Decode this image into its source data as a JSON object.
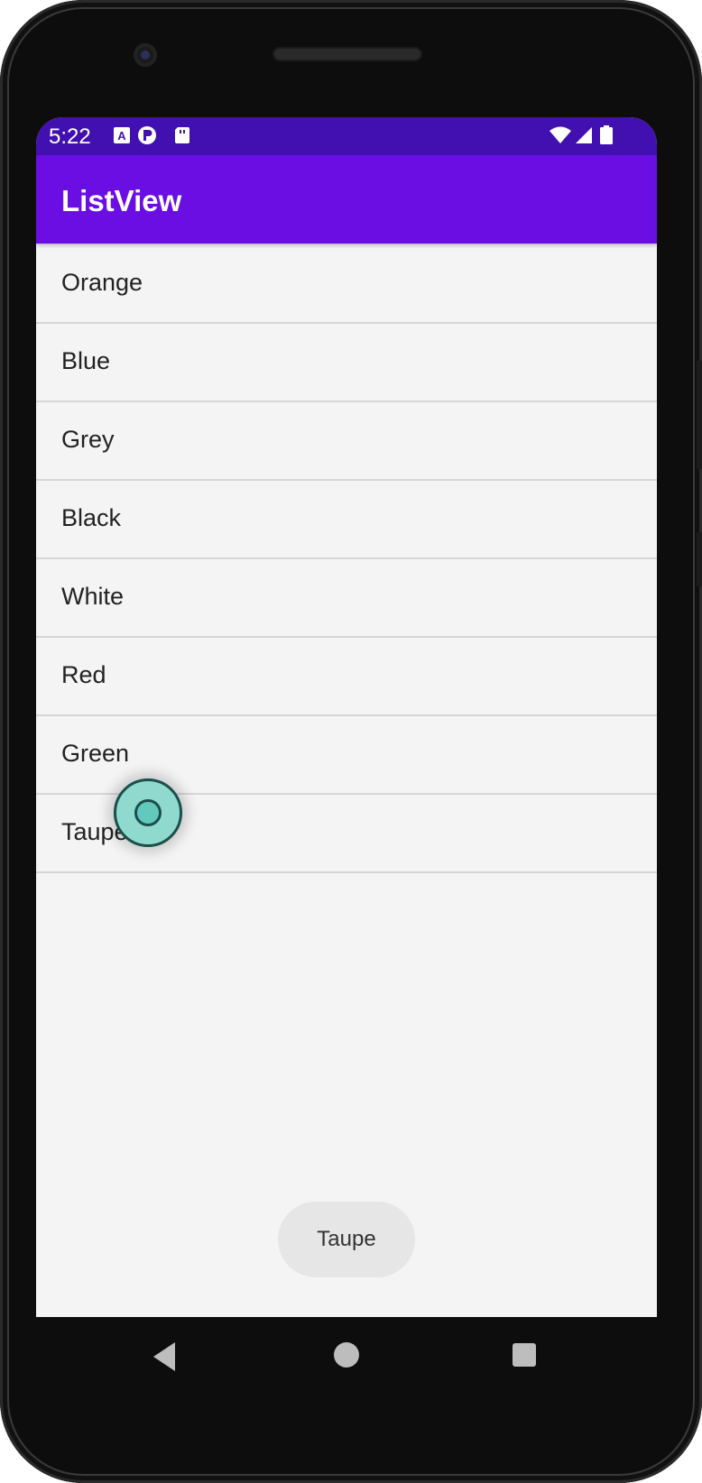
{
  "status_bar": {
    "time": "5:22",
    "left_icons": [
      "a-notification-icon",
      "p-notification-icon",
      "sd-card-icon"
    ],
    "right_icons": [
      "wifi-icon",
      "signal-icon",
      "battery-icon"
    ],
    "color": "#4210b0"
  },
  "app_bar": {
    "title": "ListView",
    "color": "#6a0ee4"
  },
  "list": {
    "items": [
      {
        "label": "Orange"
      },
      {
        "label": "Blue"
      },
      {
        "label": "Grey"
      },
      {
        "label": "Black"
      },
      {
        "label": "White"
      },
      {
        "label": "Red"
      },
      {
        "label": "Green"
      },
      {
        "label": "Taupe"
      }
    ]
  },
  "toast": {
    "text": "Taupe"
  },
  "nav_bar": {
    "buttons": [
      "back-icon",
      "home-icon",
      "recents-icon"
    ]
  }
}
